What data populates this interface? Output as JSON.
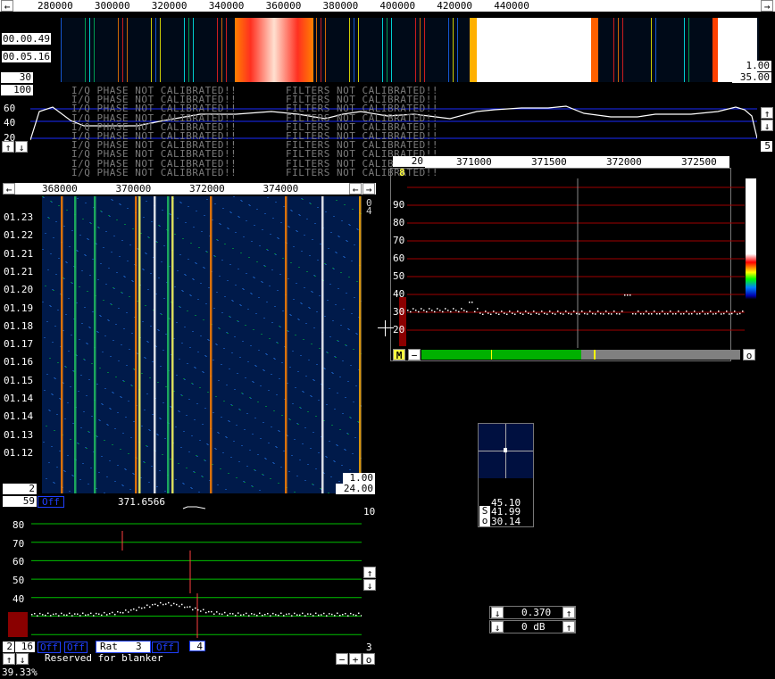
{
  "top_scale": {
    "left_arrow": "←",
    "right_arrow": "→",
    "ticks": [
      "280000",
      "300000",
      "320000",
      "340000",
      "360000",
      "380000",
      "400000",
      "420000",
      "440000"
    ]
  },
  "top_waterfall": {
    "time_labels": [
      "00.00.49",
      "00.05.16"
    ],
    "left_value": "30",
    "right_value_1": "1.00",
    "right_value_2": "35.00"
  },
  "top_spectrum": {
    "top_box": "100",
    "y_labels": [
      "60",
      "40",
      "20"
    ],
    "right_value": "5",
    "warning_left": "I/Q PHASE NOT CALIBRATED!!",
    "warning_right": "FILTERS NOT CALIBRATED!!"
  },
  "waterfall2": {
    "ticks": [
      "368000",
      "370000",
      "372000",
      "374000"
    ],
    "time_labels": [
      "01.23",
      "01.22",
      "01.21",
      "01.21",
      "01.20",
      "01.19",
      "01.18",
      "01.17",
      "01.16",
      "01.15",
      "01.14",
      "01.14",
      "01.13",
      "01.12"
    ],
    "right_small": [
      "0",
      "4"
    ],
    "bottom_left": "2",
    "bottom_right_1": "1.00",
    "bottom_right_2": "24.00"
  },
  "spectrum3": {
    "box_left": "20",
    "ticks": [
      "371000",
      "371500",
      "372000",
      "372500"
    ],
    "corner_value": "8",
    "y_labels": [
      "90",
      "80",
      "70",
      "60",
      "50",
      "40",
      "30",
      "20"
    ],
    "m_button": "M",
    "minus_button": "−",
    "o_button": "o",
    "meter_fraction": 0.5
  },
  "baseband": {
    "left_box": "59",
    "left_state": "Off",
    "frequency": "371.6566",
    "top_right": "10",
    "y_labels": [
      "80",
      "70",
      "60",
      "50",
      "40",
      "30"
    ],
    "bottom_right": "3",
    "ctrl_1": "2",
    "ctrl_2": "16",
    "ctrl_3": "Off",
    "ctrl_4": "Off",
    "rat_label": "Rat",
    "rat_value": "3",
    "ctrl_5": "Off",
    "ctrl_6": "4",
    "blanker": "Reserved for blanker",
    "btn_minus": "−",
    "btn_plus": "+",
    "btn_o": "o"
  },
  "status": {
    "percent": "39.33%"
  },
  "polar": {
    "value_1": "45.10",
    "s_label": "S",
    "value_2": "41.99",
    "o_label": "o",
    "value_3": "30.14"
  },
  "controls": {
    "row1_value": "0.370",
    "row2_value": "0 dB"
  },
  "colors": {
    "grid_red": "#a00000",
    "grid_blue": "#1a2cff",
    "grid_green": "#00c000",
    "trace": "#ffffff"
  }
}
